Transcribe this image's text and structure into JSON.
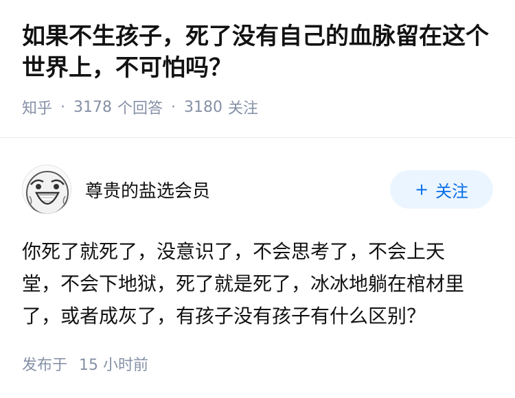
{
  "question": {
    "title": "如果不生孩子，死了没有自己的血脉留在这个世界上，不可怕吗？",
    "source": "知乎",
    "answer_count": "3178",
    "answer_label": "个回答",
    "follow_count": "3180",
    "follow_label": "关注",
    "separator": "·"
  },
  "answer": {
    "author_name": "尊贵的盐选会员",
    "follow_button": {
      "icon": "+",
      "label": "关注"
    },
    "content": "你死了就死了，没意识了，不会思考了，不会上天堂，不会下地狱，死了就是死了，冰冰地躺在棺材里了，或者成灰了，有孩子没有孩子有什么区别？",
    "publish_label": "发布于",
    "publish_time": "15 小时前"
  },
  "colors": {
    "meta_gray": "#8590a6",
    "brand_blue": "#056de8",
    "button_bg": "#ebf5ff",
    "text": "#121212"
  }
}
